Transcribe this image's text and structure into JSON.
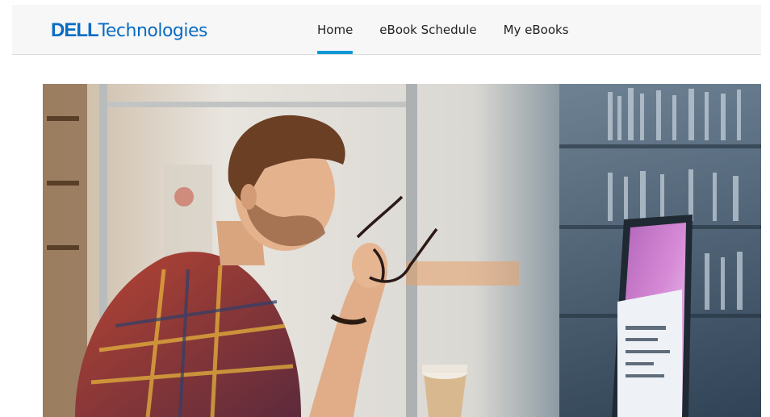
{
  "header": {
    "logo": {
      "brand": "DELL",
      "product": "Technologies",
      "color": "#0b6cc2"
    },
    "nav": [
      {
        "label": "Home",
        "active": true
      },
      {
        "label": "eBook Schedule",
        "active": false
      },
      {
        "label": "My eBooks",
        "active": false
      }
    ],
    "accent": "#0d98d8"
  },
  "hero": {
    "icon": "hero-photo-man-with-glasses-at-monitor"
  }
}
